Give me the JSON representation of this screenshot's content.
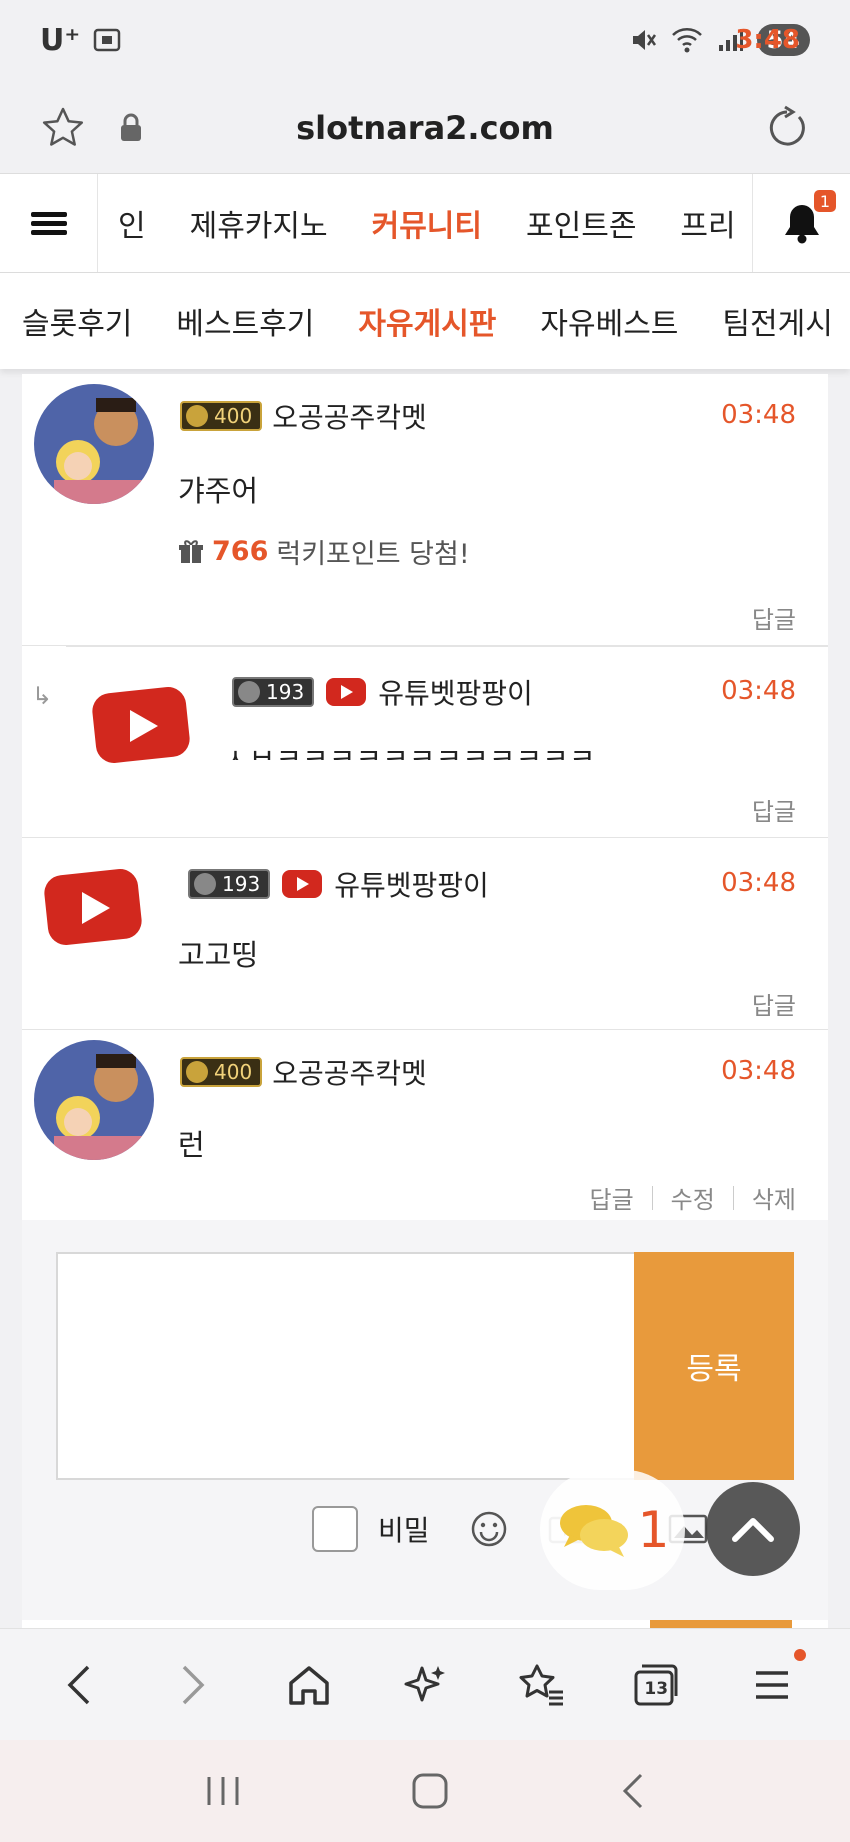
{
  "status_bar": {
    "carrier": "U⁺",
    "time": "3:48",
    "battery": "54"
  },
  "url_bar": {
    "url": "slotnara2.com"
  },
  "main_nav": {
    "items": [
      "인",
      "제휴카지노",
      "커뮤니티",
      "포인트존",
      "프리"
    ],
    "active": "커뮤니티",
    "notification_count": "1"
  },
  "sub_nav": {
    "items": [
      "슬롯후기",
      "베스트후기",
      "자유게시판",
      "자유베스트",
      "팀전게시"
    ],
    "active": "자유게시판"
  },
  "comments": [
    {
      "level": "400",
      "username": "오공공주칵멧",
      "time": "03:48",
      "text": "갸주어",
      "lucky_points": "766",
      "lucky_text": "럭키포인트 당첨!",
      "reply_label": "답글"
    },
    {
      "level": "193",
      "username": "유튜벳팡팡이",
      "time": "03:48",
      "text": "ㅅㅂㅋㅋㅋㅋㅋㅋㅋㅋㅋㅋㅋㅋ",
      "reply_label": "답글"
    },
    {
      "level": "193",
      "username": "유튜벳팡팡이",
      "time": "03:48",
      "text": "고고띵",
      "reply_label": "답글"
    },
    {
      "level": "400",
      "username": "오공공주칵멧",
      "time": "03:48",
      "text": "런",
      "reply_label": "답글",
      "edit_label": "수정",
      "delete_label": "삭제"
    }
  ],
  "comment_form": {
    "submit_label": "등록",
    "secret_label": "비밀"
  },
  "floating": {
    "chat_count": "1"
  },
  "bottom_bar": {
    "tabs_count": "13"
  },
  "colors": {
    "accent": "#e5562a",
    "submit": "#e89a3c"
  }
}
